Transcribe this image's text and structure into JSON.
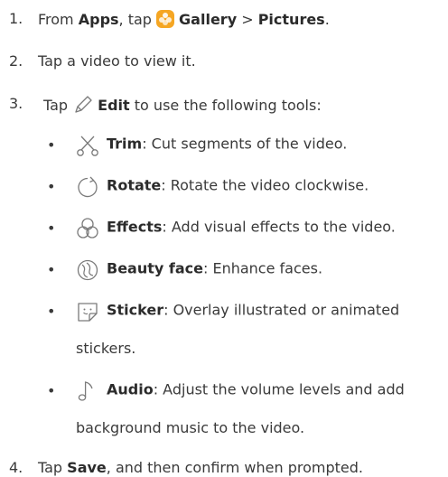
{
  "steps": [
    {
      "num": "1.",
      "pre": "From ",
      "b1": "Apps",
      "mid": ", tap ",
      "b2": "Gallery",
      "sep": " > ",
      "b3": "Pictures",
      "end": "."
    },
    {
      "num": "2.",
      "text": "Tap a video to view it."
    },
    {
      "num": "3.",
      "pre": "Tap ",
      "bold": "Edit",
      "post": " to use the following tools:"
    },
    {
      "num": "4.",
      "pre": "Tap ",
      "bold": "Save",
      "post": ", and then confirm when prompted."
    }
  ],
  "tools": [
    {
      "icon": "scissors-icon",
      "name": "Trim",
      "desc": ": Cut segments of the video."
    },
    {
      "icon": "rotate-icon",
      "name": "Rotate",
      "desc": ": Rotate the video clockwise."
    },
    {
      "icon": "effects-icon",
      "name": "Effects",
      "desc": ": Add visual effects to the video."
    },
    {
      "icon": "beauty-face-icon",
      "name": "Beauty face",
      "desc": ": Enhance faces."
    },
    {
      "icon": "sticker-icon",
      "name": "Sticker",
      "desc": ": Overlay illustrated or animated",
      "desc2": "stickers."
    },
    {
      "icon": "audio-icon",
      "name": "Audio",
      "desc": ": Adjust the volume levels and add",
      "desc2": "background music to the video."
    }
  ],
  "bullet": "•",
  "colors": {
    "text": "#3a3a3a",
    "icon": "#7a7a7a",
    "gallery": "#f5a623"
  }
}
